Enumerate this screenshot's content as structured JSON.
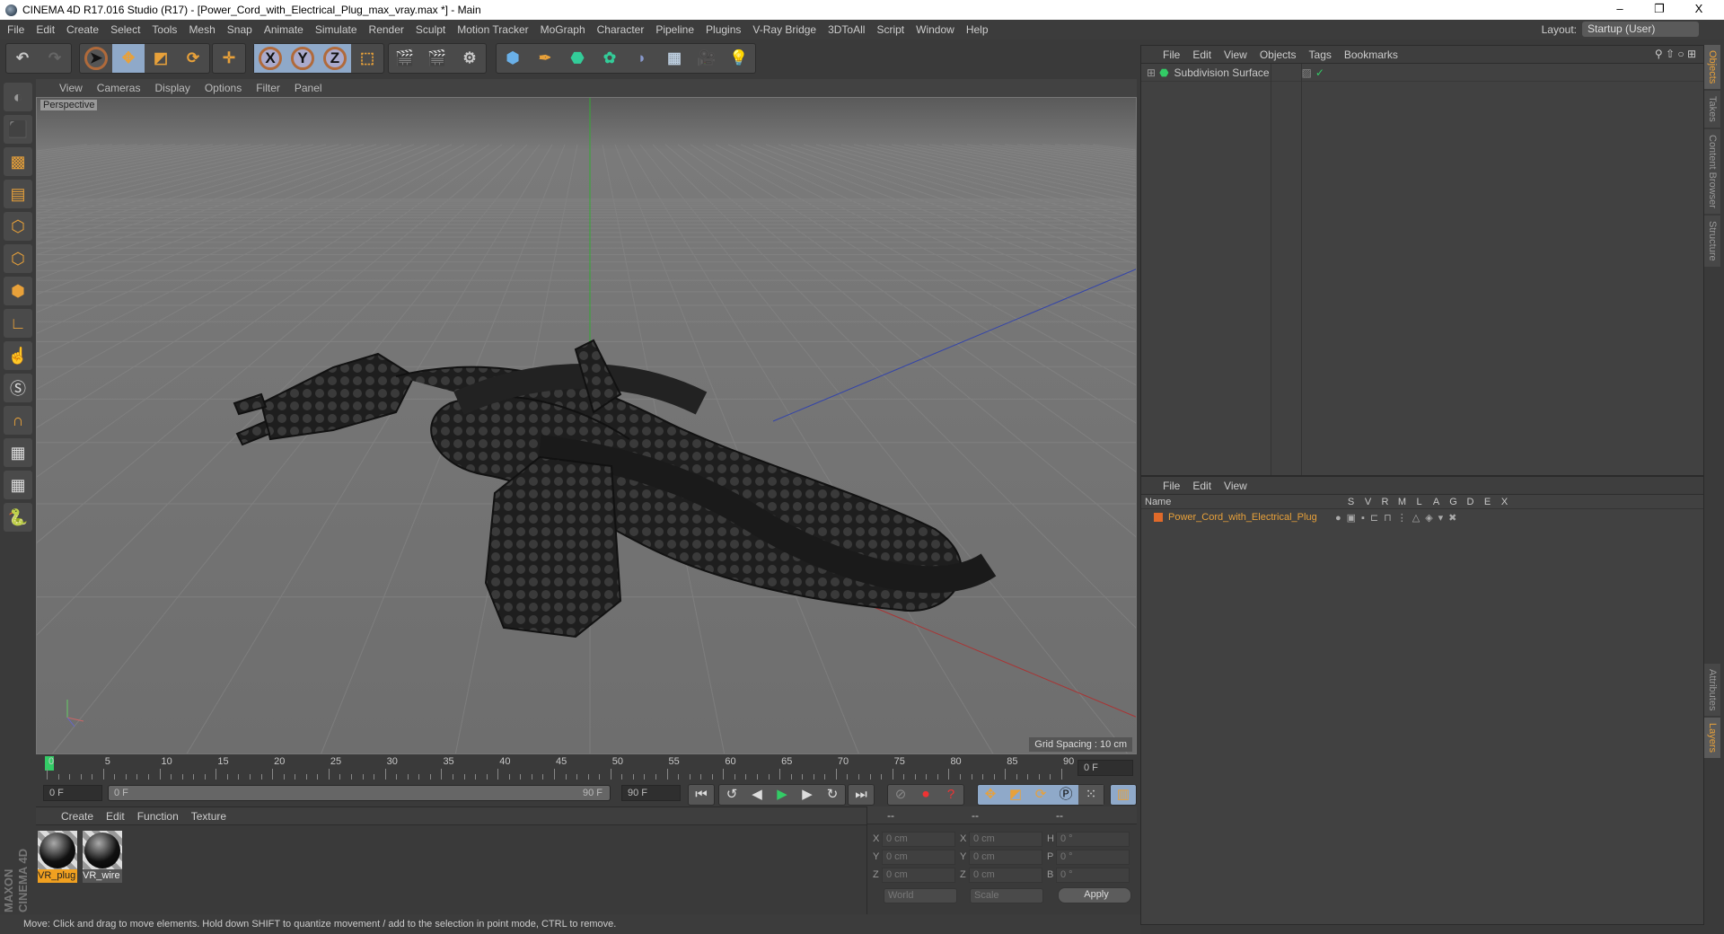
{
  "window": {
    "title": "CINEMA 4D R17.016 Studio (R17) - [Power_Cord_with_Electrical_Plug_max_vray.max *] - Main",
    "minimize": "–",
    "restore": "❐",
    "close": "X"
  },
  "menu": [
    "File",
    "Edit",
    "Create",
    "Select",
    "Tools",
    "Mesh",
    "Snap",
    "Animate",
    "Simulate",
    "Render",
    "Sculpt",
    "Motion Tracker",
    "MoGraph",
    "Character",
    "Pipeline",
    "Plugins",
    "V-Ray Bridge",
    "3DToAll",
    "Script",
    "Window",
    "Help"
  ],
  "layout": {
    "label": "Layout:",
    "value": "Startup (User)"
  },
  "toolbar": {
    "axis": [
      "X",
      "Y",
      "Z"
    ]
  },
  "viewport": {
    "menu": [
      "View",
      "Cameras",
      "Display",
      "Options",
      "Filter",
      "Panel"
    ],
    "camera": "Perspective",
    "grid_spacing": "Grid Spacing : 10 cm"
  },
  "timeline": {
    "ticks": [
      "0",
      "5",
      "10",
      "15",
      "20",
      "25",
      "30",
      "35",
      "40",
      "45",
      "50",
      "55",
      "60",
      "65",
      "70",
      "75",
      "80",
      "85",
      "90"
    ],
    "current": "0 F",
    "start": "0 F",
    "range_start": "0 F",
    "range_end": "90 F",
    "end": "90 F"
  },
  "materials": {
    "menu": [
      "Create",
      "Edit",
      "Function",
      "Texture"
    ],
    "items": [
      {
        "name": "VR_plug",
        "selected": true
      },
      {
        "name": "VR_wire",
        "selected": false
      }
    ]
  },
  "coords": {
    "headers": [
      "--",
      "--",
      "--"
    ],
    "rows": [
      [
        "X",
        "0 cm",
        "X",
        "0 cm",
        "H",
        "0 °"
      ],
      [
        "Y",
        "0 cm",
        "Y",
        "0 cm",
        "P",
        "0 °"
      ],
      [
        "Z",
        "0 cm",
        "Z",
        "0 cm",
        "B",
        "0 °"
      ]
    ],
    "mode1": "World",
    "mode2": "Scale",
    "apply": "Apply"
  },
  "status": "Move: Click and drag to move elements. Hold down SHIFT to quantize movement / add to the selection in point mode, CTRL to remove.",
  "objects": {
    "menu": [
      "File",
      "Edit",
      "View",
      "Objects",
      "Tags",
      "Bookmarks"
    ],
    "items": [
      {
        "name": "Subdivision Surface"
      }
    ]
  },
  "layers": {
    "menu": [
      "File",
      "Edit",
      "View"
    ],
    "columns": [
      "Name",
      "S",
      "V",
      "R",
      "M",
      "L",
      "A",
      "G",
      "D",
      "E",
      "X"
    ],
    "items": [
      {
        "name": "Power_Cord_with_Electrical_Plug",
        "color": "#e06a2a"
      }
    ]
  },
  "sidetabs": {
    "top": [
      "Objects",
      "Takes",
      "Content Browser",
      "Structure"
    ],
    "bottom": [
      "Attributes",
      "Layers"
    ]
  },
  "brand": "MAXON CINEMA 4D",
  "colors": {
    "accent": "#e8a13a",
    "selection": "#8fa9c9",
    "layer": "#e06a2a"
  }
}
